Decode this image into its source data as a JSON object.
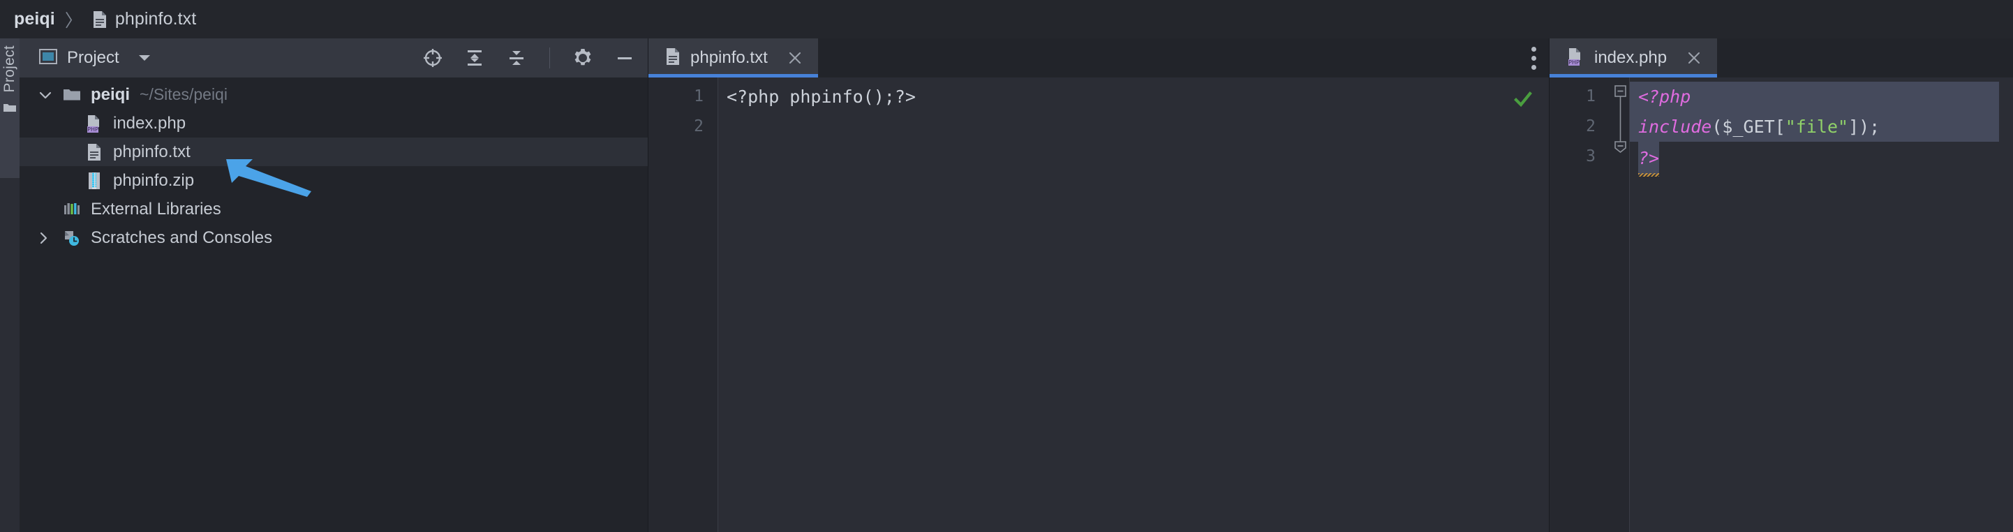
{
  "breadcrumb": {
    "root": "peiqi",
    "separator": "〉",
    "file": "phpinfo.txt",
    "file_icon": "text-file-icon"
  },
  "tool_strip": {
    "tab_label": "Project",
    "folder_icon": "folder-icon"
  },
  "project_panel": {
    "title": "Project",
    "view_icon": "project-view-icon",
    "dropdown_icon": "chevron-down-icon",
    "toolbar": [
      {
        "name": "select-opened-file-icon",
        "glyph": "target"
      },
      {
        "name": "expand-all-icon",
        "glyph": "expand"
      },
      {
        "name": "collapse-all-icon",
        "glyph": "collapse"
      },
      {
        "name": "settings-gear-icon",
        "glyph": "gear"
      },
      {
        "name": "hide-panel-icon",
        "glyph": "minus"
      }
    ]
  },
  "tree": {
    "items": [
      {
        "label": "peiqi",
        "sublabel": "~/Sites/peiqi",
        "icon": "folder-icon",
        "arrow": "chevron-down-icon",
        "depth": 0,
        "bold": true,
        "selected": false
      },
      {
        "label": "index.php",
        "sublabel": "",
        "icon": "php-file-icon",
        "arrow": "",
        "depth": 1,
        "bold": false,
        "selected": false
      },
      {
        "label": "phpinfo.txt",
        "sublabel": "",
        "icon": "text-file-icon",
        "arrow": "",
        "depth": 1,
        "bold": false,
        "selected": true
      },
      {
        "label": "phpinfo.zip",
        "sublabel": "",
        "icon": "archive-file-icon",
        "arrow": "",
        "depth": 1,
        "bold": false,
        "selected": false
      },
      {
        "label": "External Libraries",
        "sublabel": "",
        "icon": "external-libraries-icon",
        "arrow": "",
        "depth": 0,
        "bold": false,
        "selected": false
      },
      {
        "label": "Scratches and Consoles",
        "sublabel": "",
        "icon": "scratches-icon",
        "arrow": "chevron-right-icon",
        "depth": 0,
        "bold": false,
        "selected": false
      }
    ]
  },
  "editor_left": {
    "tab": {
      "title": "phpinfo.txt",
      "icon": "text-file-icon",
      "close_icon": "close-icon",
      "active": true
    },
    "kebab_icon": "more-options-icon",
    "inspection_icon": "checkmark-ok-icon",
    "line_numbers": [
      "1",
      "2"
    ],
    "lines": [
      {
        "number": "1",
        "text": "<?php phpinfo();?>"
      },
      {
        "number": "2",
        "text": ""
      }
    ]
  },
  "editor_right": {
    "tab": {
      "title": "index.php",
      "icon": "php-file-icon",
      "close_icon": "close-icon",
      "active": true
    },
    "line_numbers": [
      "1",
      "2",
      "3"
    ],
    "lines": [
      {
        "number": "1",
        "highlighted": true,
        "tokens": [
          {
            "text": "<?php",
            "type": "keyword"
          }
        ]
      },
      {
        "number": "2",
        "highlighted": true,
        "tokens": [
          {
            "text": "include",
            "type": "func"
          },
          {
            "text": "(",
            "type": "punct"
          },
          {
            "text": "$_GET",
            "type": "var"
          },
          {
            "text": "[",
            "type": "punct"
          },
          {
            "text": "\"file\"",
            "type": "string"
          },
          {
            "text": "]",
            "type": "punct"
          },
          {
            "text": ");",
            "type": "punct"
          }
        ]
      },
      {
        "number": "3",
        "highlighted": false,
        "tokens": [
          {
            "text": "?>",
            "type": "keyword",
            "warning": true
          }
        ]
      }
    ]
  },
  "annotation": {
    "type": "arrow",
    "color": "#4BA3E8",
    "points_to": "phpinfo.zip"
  },
  "colors": {
    "background": "#1e2025",
    "panel": "#22242a",
    "panel_header": "#353841",
    "editor_bg": "#2b2d35",
    "tab_active": "#383b44",
    "tab_underline": "#4781d8",
    "selection": "#454a5c",
    "text": "#c6cbd3",
    "text_dim": "#737984",
    "keyword": "#e06ce0",
    "string": "#90d169",
    "check_green": "#4a9e3f",
    "arrow_blue": "#4BA3E8"
  }
}
